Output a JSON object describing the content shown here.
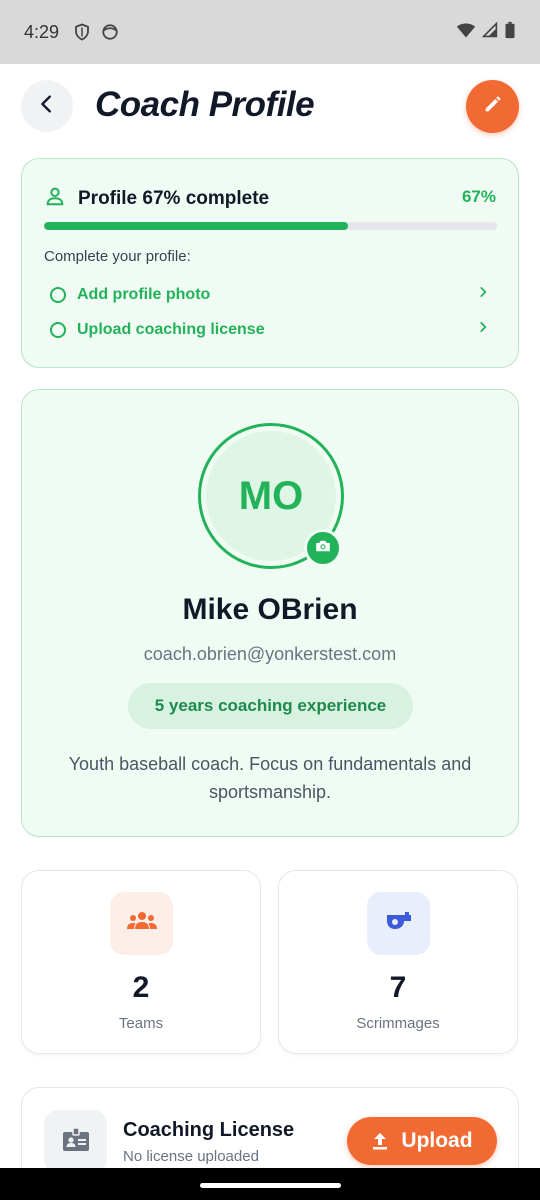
{
  "status_bar": {
    "time": "4:29",
    "icons": [
      "shield-icon",
      "face-icon",
      "wifi-icon",
      "signal-icon",
      "battery-icon"
    ]
  },
  "header": {
    "title": "Coach Profile",
    "back_icon": "back-arrow-icon",
    "edit_icon": "pencil-icon"
  },
  "progress": {
    "title": "Profile 67% complete",
    "percent_label": "67%",
    "percent_value": 0.67,
    "subtitle": "Complete your profile:",
    "tasks": [
      {
        "label": "Add profile photo"
      },
      {
        "label": "Upload coaching license"
      }
    ]
  },
  "profile": {
    "initials": "MO",
    "name": "Mike OBrien",
    "email": "coach.obrien@yonkerstest.com",
    "experience": "5 years coaching experience",
    "bio": "Youth baseball coach. Focus on fundamentals and sportsmanship."
  },
  "stats": [
    {
      "value": "2",
      "label": "Teams",
      "icon": "group-icon"
    },
    {
      "value": "7",
      "label": "Scrimmages",
      "icon": "whistle-icon"
    }
  ],
  "license": {
    "title": "Coaching License",
    "status": "No license uploaded",
    "upload_label": "Upload"
  },
  "colors": {
    "accent_orange": "#f26a33",
    "accent_green": "#22b35a",
    "card_green_bg": "#f0fbf4",
    "card_green_border": "#b8e6c8"
  }
}
